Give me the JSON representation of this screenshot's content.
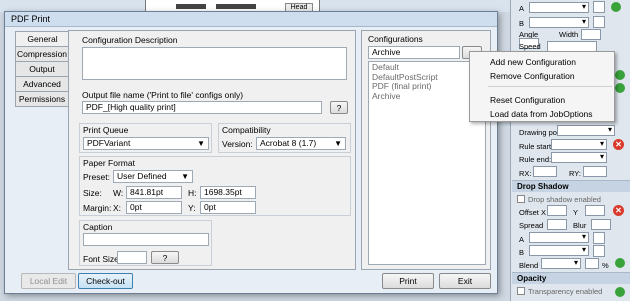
{
  "background_app": {
    "head_label": "Head",
    "right_panel": {
      "labels": [
        "A",
        "B",
        "Angle",
        "Width",
        "Speed",
        "Drawing pos:",
        "Rule start:",
        "Rule end:",
        "RX:",
        "RY:",
        "Offset X",
        "Y",
        "Spread",
        "Blur",
        "A",
        "B",
        "Blend",
        "%"
      ],
      "sections": [
        "Drop Shadow",
        "Opacity"
      ],
      "checkboxes": [
        "Drop shadow enabled",
        "Transparency enabled"
      ]
    }
  },
  "window": {
    "title": "PDF Print"
  },
  "tabs": [
    {
      "label": "General",
      "selected": true
    },
    {
      "label": "Compression",
      "selected": false
    },
    {
      "label": "Output",
      "selected": false
    },
    {
      "label": "Advanced",
      "selected": false
    },
    {
      "label": "Permissions",
      "selected": false
    }
  ],
  "general": {
    "config_description_title": "Configuration Description",
    "config_description_value": "",
    "output_file_title": "Output file name ('Print to file' configs only)",
    "output_file_value": "PDF_[High quality print]",
    "browse_label": "?",
    "print_queue_title": "Print Queue",
    "print_queue_value": "PDFVariant",
    "compatibility_title": "Compatibility",
    "version_label": "Version:",
    "version_value": "Acrobat 8 (1.7)",
    "paper_format_title": "Paper Format",
    "preset_label": "Preset:",
    "preset_value": "User Defined",
    "size_label": "Size:",
    "w_label": "W:",
    "w_value": "841.81pt",
    "h_label": "H:",
    "h_value": "1698.35pt",
    "margin_label": "Margin:",
    "x_label": "X:",
    "x_value": "0pt",
    "y_label": "Y:",
    "y_value": "0pt",
    "caption_title": "Caption",
    "caption_value": "",
    "font_size_label": "Font Size:",
    "font_size_value": "",
    "font_btn_label": "?"
  },
  "configurations": {
    "title": "Configurations",
    "selected": "Archive",
    "arrow_label": ">",
    "items": [
      "Default",
      "DefaultPostScript",
      "PDF (final print)",
      "Archive"
    ]
  },
  "context_menu": {
    "items": [
      "Add new Configuration",
      "Remove Configuration",
      "Reset Configuration",
      "Load data from JobOptions"
    ]
  },
  "footer": {
    "local_edit": "Local Edit",
    "check_out": "Check-out",
    "print": "Print",
    "exit": "Exit"
  }
}
